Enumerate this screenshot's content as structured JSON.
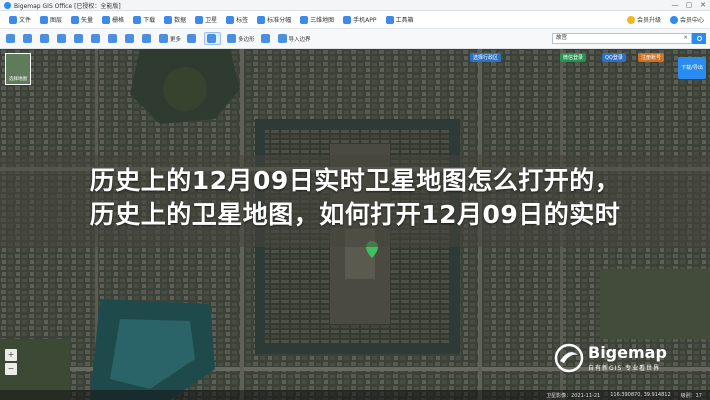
{
  "titlebar": {
    "title": "Bigemap GIS Office [已授权：全能版]",
    "controls": [
      "—",
      "▢",
      "✕"
    ]
  },
  "menubar": {
    "items": [
      {
        "label": "文件",
        "icon": "file-icon"
      },
      {
        "label": "图层",
        "icon": "layers-icon"
      },
      {
        "label": "矢量",
        "icon": "vector-icon"
      },
      {
        "label": "栅格",
        "icon": "raster-icon"
      },
      {
        "label": "下载",
        "icon": "download-icon"
      },
      {
        "label": "数据",
        "icon": "data-icon"
      },
      {
        "label": "卫星",
        "icon": "satellite-icon"
      },
      {
        "label": "标签",
        "icon": "tag-icon"
      },
      {
        "label": "标准分幅",
        "icon": "grid-icon"
      },
      {
        "label": "三维地图",
        "icon": "3d-icon"
      },
      {
        "label": "手机APP",
        "icon": "phone-icon"
      },
      {
        "label": "工具箱",
        "icon": "toolbox-icon"
      }
    ],
    "right_items": [
      {
        "label": "会员升级",
        "icon": "coin-icon"
      },
      {
        "label": "会员中心",
        "icon": "member-icon"
      }
    ]
  },
  "toolbar": {
    "items": [
      {
        "label": "",
        "icon": "select-icon"
      },
      {
        "label": "",
        "icon": "region-icon"
      },
      {
        "label": "",
        "icon": "pan-icon"
      },
      {
        "label": "",
        "icon": "layer-icon"
      },
      {
        "label": "",
        "icon": "measure-icon"
      },
      {
        "label": "",
        "icon": "pin-icon"
      },
      {
        "label": "",
        "icon": "route-icon"
      },
      {
        "label": "",
        "icon": "folder-icon"
      },
      {
        "label": "",
        "icon": "grid2-icon"
      },
      {
        "label": "更多",
        "icon": "more-icon"
      },
      {
        "label": "",
        "icon": "draw-icon"
      },
      {
        "label": "",
        "icon": "area-icon"
      },
      {
        "label": "多边形",
        "icon": "polygon-icon"
      },
      {
        "label": "",
        "icon": "export-icon"
      },
      {
        "label": "导入边界",
        "icon": "import-icon"
      }
    ],
    "search_value": "故宫",
    "search_clear": "✕"
  },
  "map": {
    "switch_label": "选择地图",
    "chips": {
      "select_region": "选择行政区",
      "login_wechat": "微信登录",
      "login_qq": "QQ登录",
      "signup": "注册账号",
      "download": "下载/导出"
    },
    "controls": [
      "+",
      "−"
    ],
    "headline_line1": "历史上的12月09日实时卫星地图怎么打开的，",
    "headline_line2": "历史上的卫星地图，如何打开12月09日的实时",
    "watermark_brand": "Bigemap",
    "watermark_tagline": "自有新GIS 专业看世界"
  },
  "status": {
    "imagery_date": "卫星影像：2021-11-21",
    "coords": "116.390870, 39.914812",
    "level": "级别：17"
  }
}
